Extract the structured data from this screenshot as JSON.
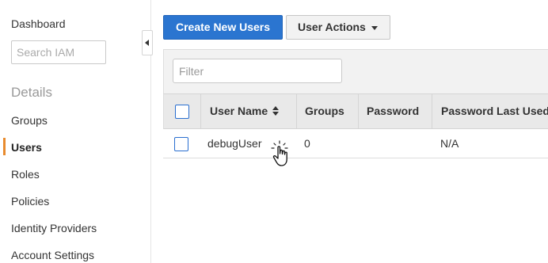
{
  "sidebar": {
    "dashboard": "Dashboard",
    "search_placeholder": "Search IAM",
    "section_heading": "Details",
    "items": [
      {
        "label": "Groups"
      },
      {
        "label": "Users",
        "active": true
      },
      {
        "label": "Roles"
      },
      {
        "label": "Policies"
      },
      {
        "label": "Identity Providers"
      },
      {
        "label": "Account Settings"
      }
    ]
  },
  "toolbar": {
    "create_label": "Create New Users",
    "actions_label": "User Actions"
  },
  "filter": {
    "placeholder": "Filter",
    "value": ""
  },
  "table": {
    "columns": [
      "User Name",
      "Groups",
      "Password",
      "Password Last Used"
    ],
    "rows": [
      {
        "user_name": "debugUser",
        "groups": "0",
        "password": "",
        "password_last_used": "N/A"
      }
    ]
  },
  "colors": {
    "primary": "#2b75d0",
    "active_indicator": "#e88b2e",
    "header_bg": "#e9e9e9"
  },
  "icons": {
    "collapse": "chevron-left-icon",
    "actions_caret": "caret-down-icon",
    "sort": "sort-icon",
    "cursor": "hand-pointer-icon"
  }
}
